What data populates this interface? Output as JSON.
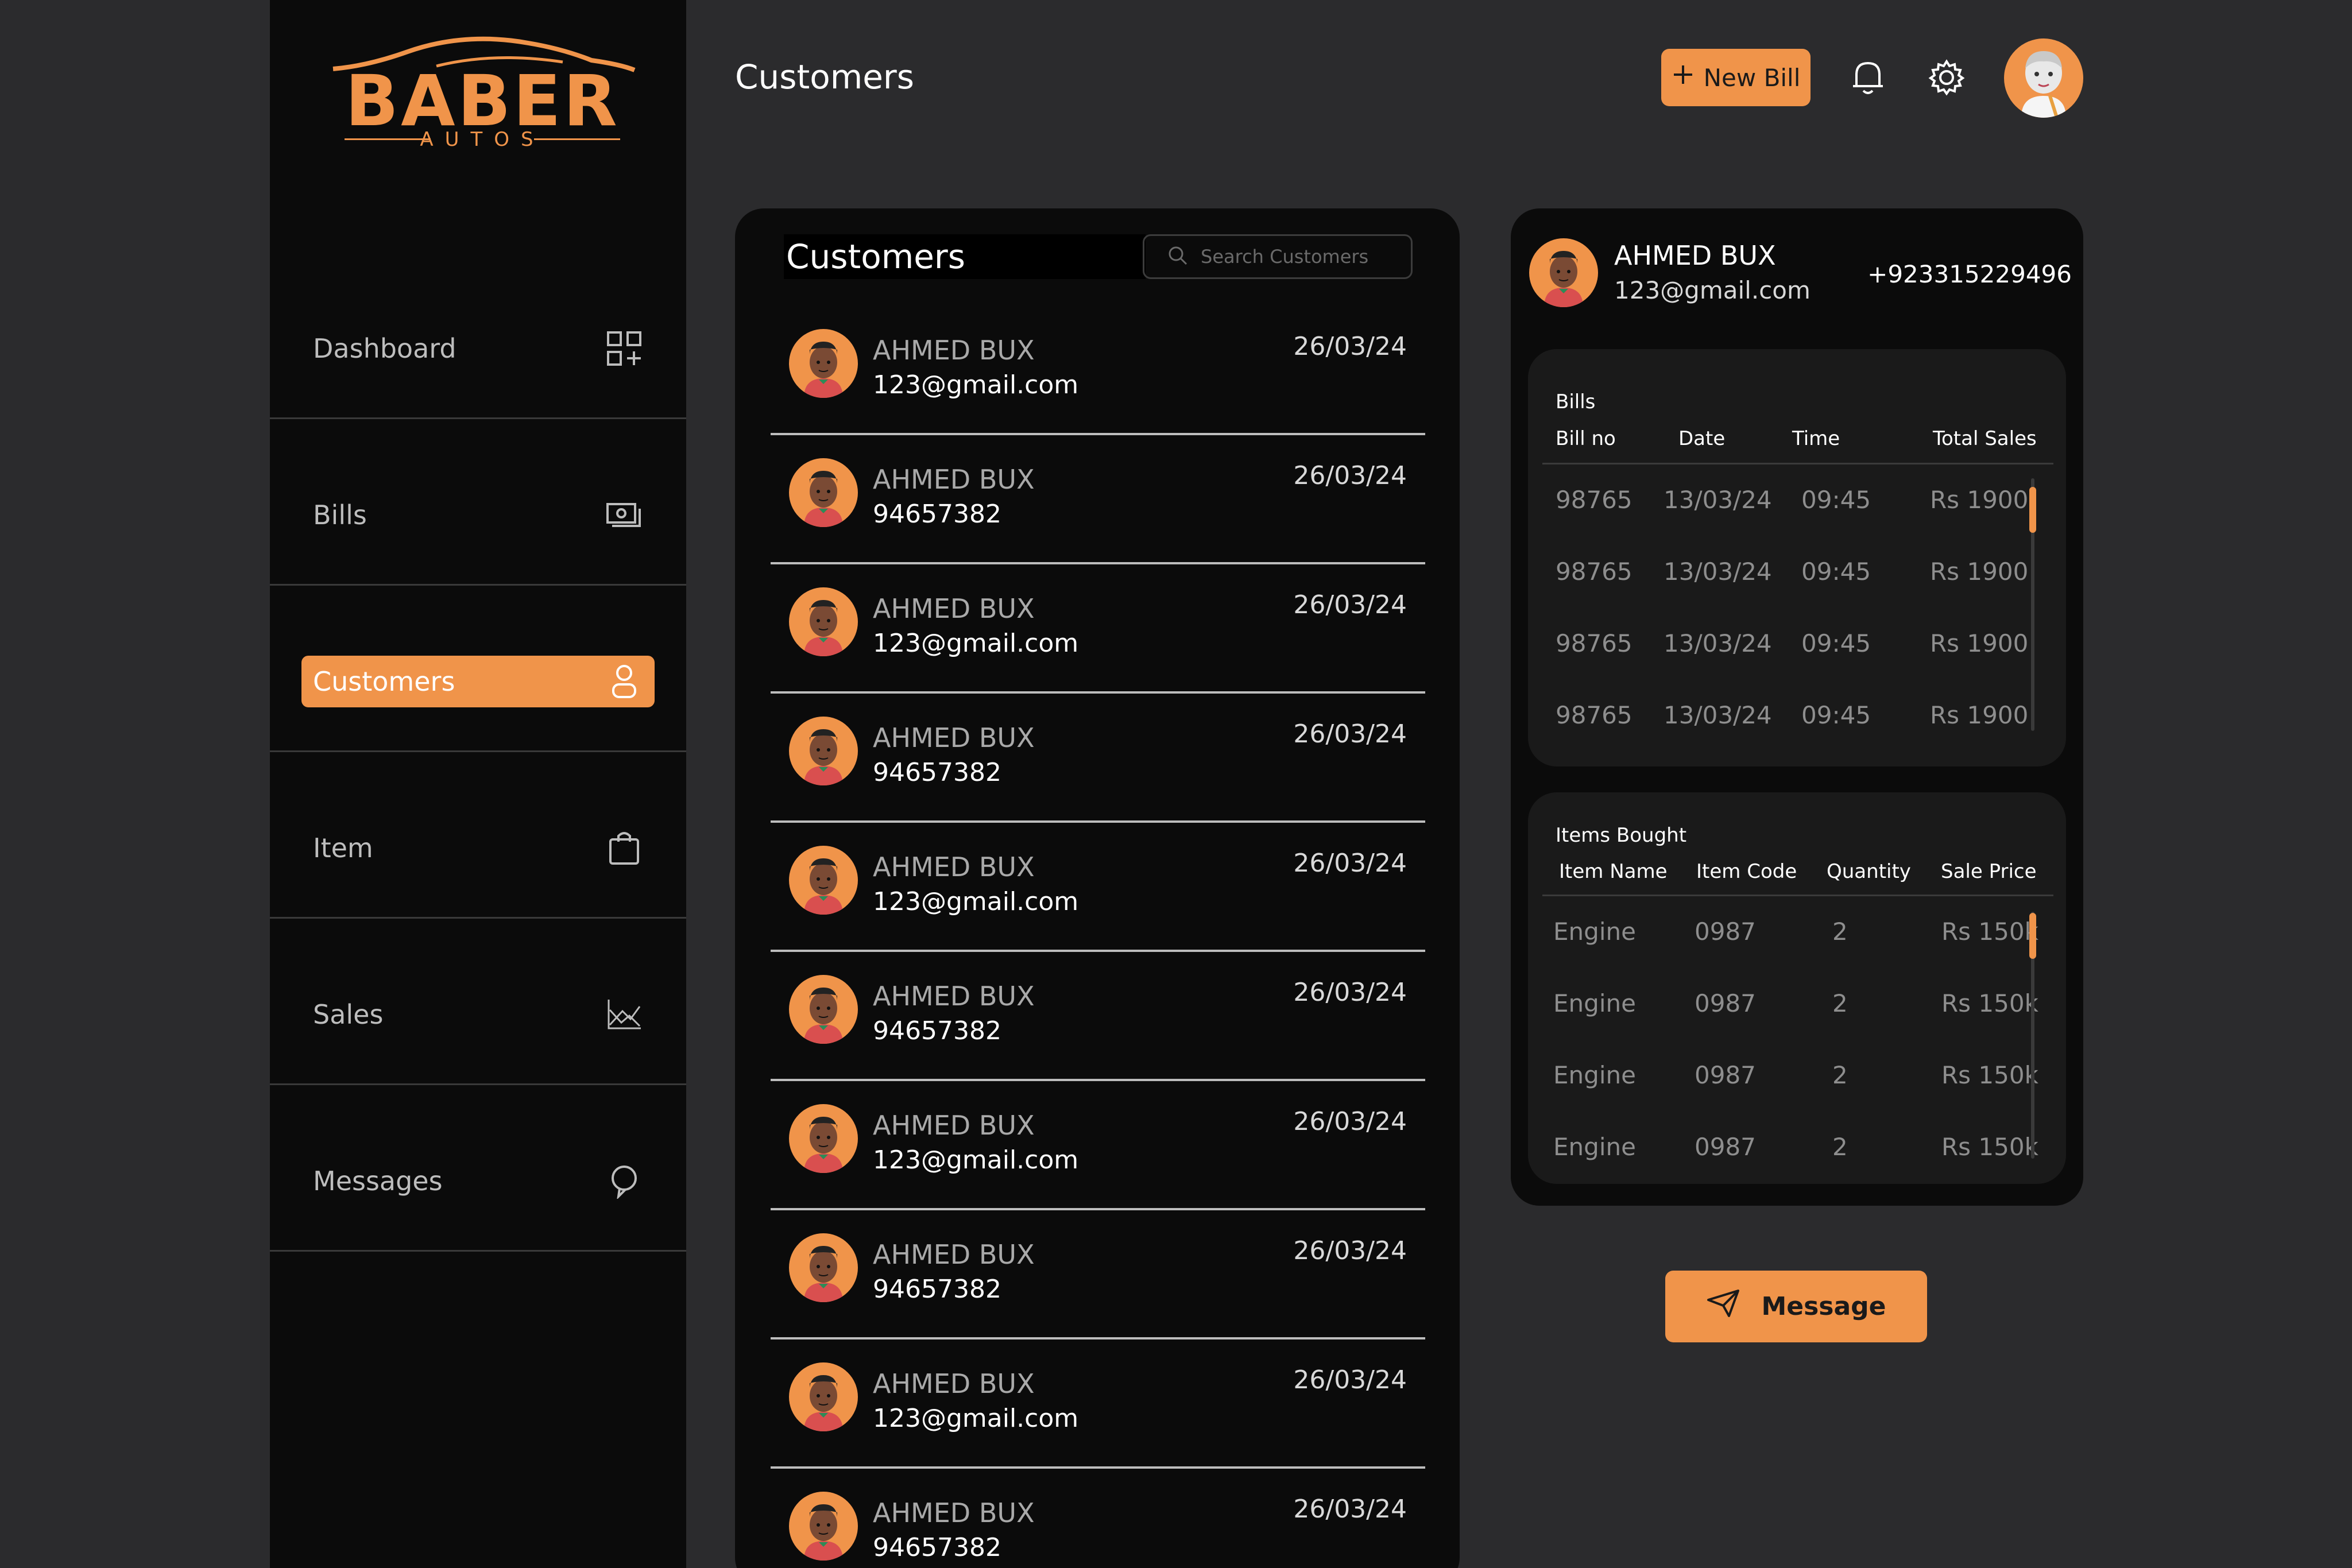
{
  "brand": {
    "name": "BABER",
    "sub": "AUTOS"
  },
  "sidebar": {
    "items": [
      {
        "label": "Dashboard",
        "icon": "dashboard-grid-icon",
        "active": false
      },
      {
        "label": "Bills",
        "icon": "money-bill-icon",
        "active": false
      },
      {
        "label": "Customers",
        "icon": "user-icon",
        "active": true
      },
      {
        "label": "Item",
        "icon": "shopping-bag-icon",
        "active": false
      },
      {
        "label": "Sales",
        "icon": "chart-icon",
        "active": false
      },
      {
        "label": "Messages",
        "icon": "chat-bubble-icon",
        "active": false
      }
    ]
  },
  "header": {
    "title": "Customers",
    "new_bill_label": "New Bill"
  },
  "customers_list": {
    "title": "Customers",
    "search_placeholder": "Search Customers",
    "rows": [
      {
        "name": "AHMED BUX",
        "sub": "123@gmail.com",
        "date": "26/03/24"
      },
      {
        "name": "AHMED BUX",
        "sub": "94657382",
        "date": "26/03/24"
      },
      {
        "name": "AHMED BUX",
        "sub": "123@gmail.com",
        "date": "26/03/24"
      },
      {
        "name": "AHMED BUX",
        "sub": "94657382",
        "date": "26/03/24"
      },
      {
        "name": "AHMED BUX",
        "sub": "123@gmail.com",
        "date": "26/03/24"
      },
      {
        "name": "AHMED BUX",
        "sub": "94657382",
        "date": "26/03/24"
      },
      {
        "name": "AHMED BUX",
        "sub": "123@gmail.com",
        "date": "26/03/24"
      },
      {
        "name": "AHMED BUX",
        "sub": "94657382",
        "date": "26/03/24"
      },
      {
        "name": "AHMED BUX",
        "sub": "123@gmail.com",
        "date": "26/03/24"
      },
      {
        "name": "AHMED BUX",
        "sub": "94657382",
        "date": "26/03/24"
      }
    ]
  },
  "detail": {
    "name": "AHMED BUX",
    "email": "123@gmail.com",
    "phone": "+923315229496",
    "bills": {
      "title": "Bills",
      "headers": [
        "Bill no",
        "Date",
        "Time",
        "Total Sales"
      ],
      "rows": [
        [
          "98765",
          "13/03/24",
          "09:45",
          "Rs 1900"
        ],
        [
          "98765",
          "13/03/24",
          "09:45",
          "Rs 1900"
        ],
        [
          "98765",
          "13/03/24",
          "09:45",
          "Rs 1900"
        ],
        [
          "98765",
          "13/03/24",
          "09:45",
          "Rs 1900"
        ]
      ]
    },
    "items": {
      "title": "Items Bought",
      "headers": [
        "Item Name",
        "Item Code",
        "Quantity",
        "Sale Price"
      ],
      "rows": [
        [
          "Engine",
          "0987",
          "2",
          "Rs 150k"
        ],
        [
          "Engine",
          "0987",
          "2",
          "Rs 150k"
        ],
        [
          "Engine",
          "0987",
          "2",
          "Rs 150k"
        ],
        [
          "Engine",
          "0987",
          "2",
          "Rs 150k"
        ]
      ]
    },
    "message_label": "Message"
  },
  "colors": {
    "accent": "#f0944a",
    "panel": "#0b0b0b",
    "background": "#2b2b2d"
  }
}
